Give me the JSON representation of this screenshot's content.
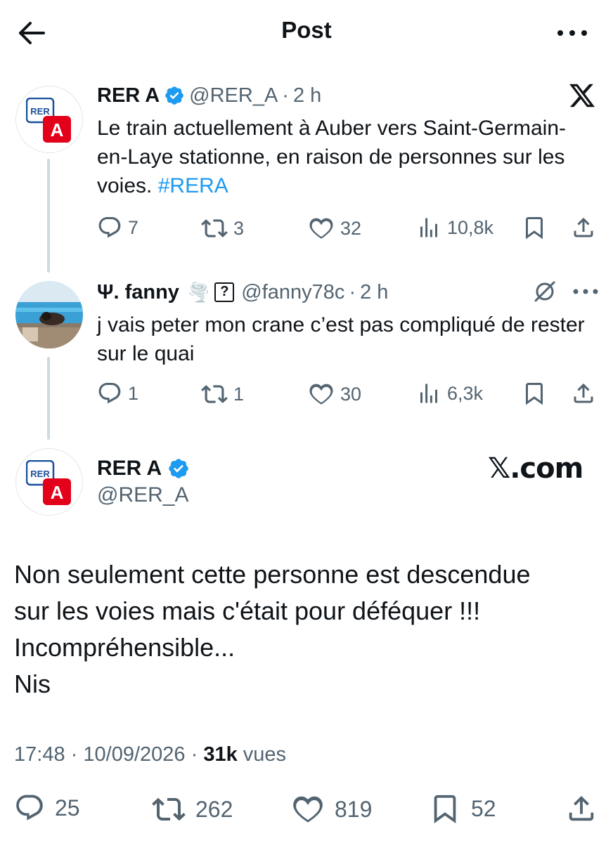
{
  "header": {
    "title": "Post",
    "back_icon": "arrow-left-icon",
    "more_icon": "more-dots-icon"
  },
  "quoted_thread": [
    {
      "author_name": "RER A",
      "handle": "@RER_A",
      "separator": "·",
      "time": "2 h",
      "text": "Le train actuellement à Auber vers Saint-Germain-en-Laye stationne, en raison de personnes sur les voies.",
      "hashtag": "#RERA",
      "source_icon": "x-logo-icon",
      "stats": {
        "replies": "7",
        "reposts": "3",
        "likes": "32",
        "views": "10,8k"
      }
    },
    {
      "author_name": "Ψ. fanny",
      "emoji": "🌪️",
      "badge": "?",
      "handle": "@fanny78c",
      "separator": "·",
      "time": "2 h",
      "text": "j vais peter mon crane c’est pas compliqué de rester sur le quai",
      "stats": {
        "replies": "1",
        "reposts": "1",
        "likes": "30",
        "views": "6,3k"
      }
    }
  ],
  "main_post": {
    "author_name": "RER A",
    "handle": "@RER_A",
    "watermark": "𝕏.com",
    "text_lines": [
      "Non seulement cette personne est descendue",
      "sur les voies mais c'était pour déféquer !!!",
      "Incompréhensible...",
      "Nis"
    ],
    "time": "17:48",
    "date": "10/09/2026",
    "separator": "·",
    "views_count": "31k",
    "views_label": "vues",
    "stats": {
      "replies": "25",
      "reposts": "262",
      "likes": "819",
      "bookmarks": "52"
    }
  },
  "avatar_logo": {
    "top": "RER",
    "bottom": "A"
  },
  "colors": {
    "accent": "#1d9bf0",
    "muted": "#536471",
    "text": "#0f1419",
    "rer_red": "#e2001a",
    "rer_blue": "#1a4f9c"
  }
}
